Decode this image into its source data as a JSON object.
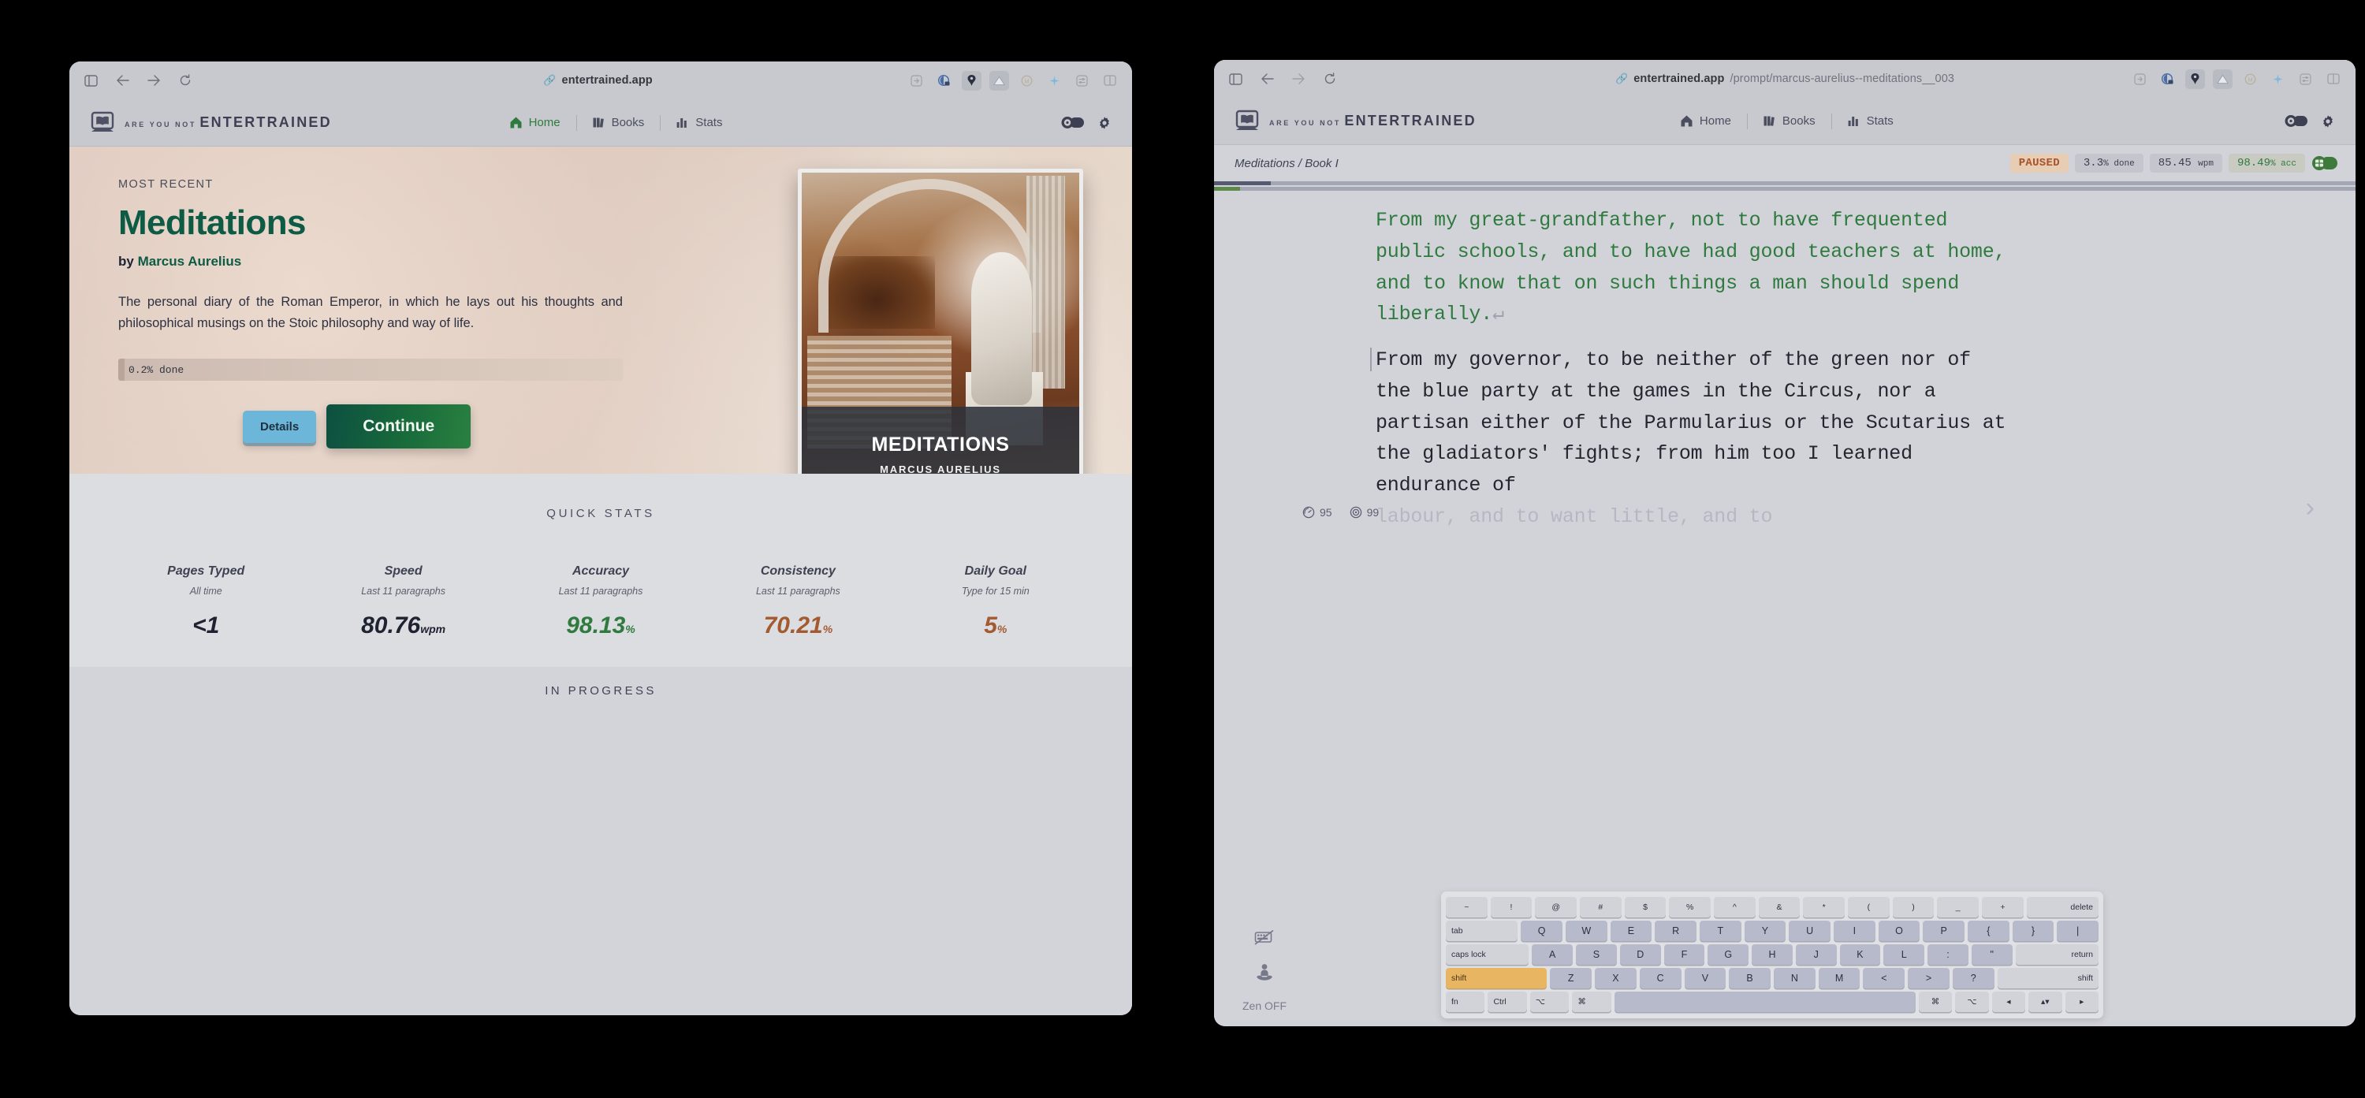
{
  "browser": {
    "left": {
      "url_domain": "entertrained.app",
      "url_path": "",
      "nav_icons": [
        "sidebar-icon",
        "back-icon",
        "forward-icon",
        "reload-icon"
      ],
      "extension_icons": [
        "share-icon",
        "shield-lock-icon",
        "password-icon",
        "cloud-icon",
        "circle-m-icon",
        "sparkle-icon",
        "sliders-icon",
        "tabs-icon"
      ]
    },
    "right": {
      "url_domain": "entertrained.app",
      "url_path": "/prompt/marcus-aurelius--meditations__003",
      "nav_icons": [
        "sidebar-icon",
        "back-icon",
        "forward-icon",
        "reload-icon"
      ],
      "extension_icons": [
        "share-icon",
        "shield-lock-icon",
        "password-icon",
        "cloud-icon",
        "circle-m-icon",
        "sparkle-icon",
        "sliders-icon",
        "tabs-icon"
      ]
    }
  },
  "app": {
    "brand_top": "ARE YOU NOT",
    "brand_bottom": "ENTERTRAINED",
    "nav": [
      {
        "label": "Home",
        "icon": "home-icon",
        "active": true
      },
      {
        "label": "Books",
        "icon": "books-icon",
        "active": false
      },
      {
        "label": "Stats",
        "icon": "bar-chart-icon",
        "active": false
      }
    ],
    "header_actions": [
      "theme-toggle",
      "settings-gear-icon"
    ]
  },
  "home": {
    "kicker": "MOST RECENT",
    "book_title": "Meditations",
    "by_prefix": "by",
    "author": "Marcus Aurelius",
    "description": "The personal diary of the Roman Emperor, in which he lays out his thoughts and philosophical musings on the Stoic philosophy and way of life.",
    "progress_label": "0.2% done",
    "progress_percent": 0.2,
    "details_button": "Details",
    "continue_button": "Continue",
    "cover": {
      "title": "MEDITATIONS",
      "author": "MARCUS AURELIUS"
    },
    "quick_stats": {
      "heading": "QUICK STATS",
      "items": [
        {
          "label": "Pages Typed",
          "sub": "All time",
          "value": "<1",
          "unit": "",
          "tone": "neutral"
        },
        {
          "label": "Speed",
          "sub": "Last 11 paragraphs",
          "value": "80.76",
          "unit": "wpm",
          "tone": "neutral"
        },
        {
          "label": "Accuracy",
          "sub": "Last 11 paragraphs",
          "value": "98.13",
          "unit": "%",
          "tone": "green"
        },
        {
          "label": "Consistency",
          "sub": "Last 11 paragraphs",
          "value": "70.21",
          "unit": "%",
          "tone": "rust"
        },
        {
          "label": "Daily Goal",
          "sub": "Type for 15 min",
          "value": "5",
          "unit": "%",
          "tone": "rust"
        }
      ]
    },
    "in_progress_heading": "IN PROGRESS"
  },
  "reader": {
    "breadcrumb": "Meditations / Book I",
    "status_chip": "PAUSED",
    "chips": [
      {
        "value": "3.3",
        "unit": "% done"
      },
      {
        "value": "85.45",
        "unit": "wpm"
      },
      {
        "value": "98.49",
        "unit": "% acc"
      }
    ],
    "toggle_state": "on",
    "progress_overall_percent": 5,
    "progress_session_percent": 2.3,
    "side_metrics": [
      {
        "icon": "speedometer-icon",
        "value": "95"
      },
      {
        "icon": "target-icon",
        "value": "99"
      }
    ],
    "paragraph_completed": "From my great-grandfather, not to have frequented public schools, and to have had good teachers at home, and to know that on such things a man should spend liberally.",
    "paragraph_completed_return_glyph": "↵",
    "paragraph_current": "From my governor, to be neither of the green nor of the blue party at the games in the Circus, nor a partisan either of the Parmularius or the Scutarius at the gladiators' fights; from him too I learned endurance of",
    "paragraph_upcoming": "labour, and to want little, and to",
    "next_arrow_glyph": "›",
    "zen_label": "Zen OFF",
    "zen_icons": [
      "keyboard-off-icon",
      "meditation-icon"
    ],
    "keyboard": {
      "row1": [
        "~",
        "!",
        "@",
        "#",
        "$",
        "%",
        "^",
        "&",
        "*",
        "(",
        ")",
        "_",
        "+",
        "delete"
      ],
      "row2": [
        "tab",
        "Q",
        "W",
        "E",
        "R",
        "T",
        "Y",
        "U",
        "I",
        "O",
        "P",
        "{",
        "}",
        "|"
      ],
      "row3": [
        "caps lock",
        "A",
        "S",
        "D",
        "F",
        "G",
        "H",
        "J",
        "K",
        "L",
        ":",
        "\"",
        "return"
      ],
      "row4": [
        "shift",
        "Z",
        "X",
        "C",
        "V",
        "B",
        "N",
        "M",
        "<",
        ">",
        "?",
        "shift"
      ],
      "row5": [
        "fn",
        "Ctrl",
        "⌥",
        "⌘",
        "",
        "⌘",
        "⌥",
        "◂",
        "▴▾",
        "▸"
      ],
      "highlighted_key": "shift"
    }
  },
  "colors": {
    "accent_green": "#2f7a3e",
    "title_green": "#0e5b45",
    "rust": "#a45a31",
    "details_blue": "#6cb6da",
    "paused_bg": "#e8cdb5",
    "shift_highlight": "#e8b662"
  }
}
